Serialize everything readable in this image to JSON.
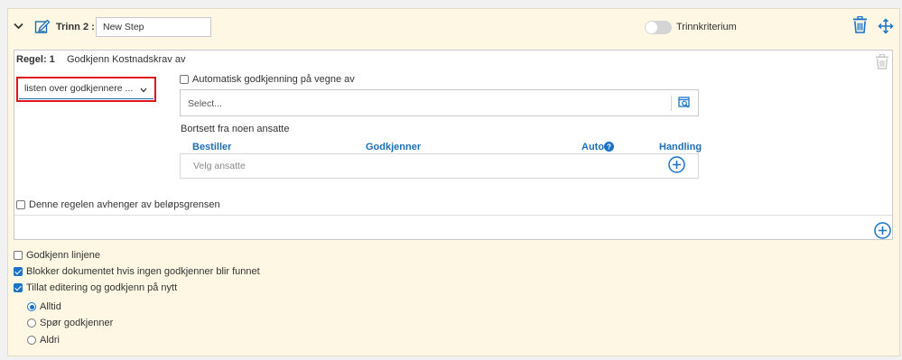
{
  "step": {
    "label": "Trinn 2 :",
    "name_value": "New Step",
    "criteria_label": "Trinnkriterium",
    "criteria_enabled": false
  },
  "rule": {
    "number_label": "Regel: 1",
    "name": "Godkjenn Kostnadskrav av",
    "approver_select": "listen over godkjennere ...",
    "auto_approve_label": "Automatisk godkjenning på vegne av",
    "auto_approve_checked": false,
    "select_placeholder": "Select...",
    "exclude_label": "Bortsett fra noen ansatte",
    "table": {
      "col_orderer": "Bestiller",
      "col_approver": "Godkjenner",
      "col_auto": "Auto",
      "col_action": "Handling",
      "empty_text": "Velg ansatte"
    },
    "amount_dependency_label": "Denne regelen avhenger av beløpsgrensen",
    "amount_dependency_checked": false
  },
  "options": [
    {
      "label": "Godkjenn linjene",
      "checked": false
    },
    {
      "label": "Blokker dokumentet hvis ingen godkjenner blir funnet",
      "checked": true
    },
    {
      "label": "Tillat editering og godkjenn på nytt",
      "checked": true
    }
  ],
  "edit_mode": [
    {
      "label": "Alltid",
      "selected": true
    },
    {
      "label": "Spør godkjenner",
      "selected": false
    },
    {
      "label": "Aldri",
      "selected": false
    }
  ],
  "colors": {
    "accent": "#1a73c7",
    "panel_bg": "#fdf7e3",
    "highlight": "#e0141b"
  },
  "icons": [
    "chevron-down-icon",
    "edit-step-icon",
    "trash-icon",
    "move-icon",
    "trash-disabled-icon",
    "lookup-icon",
    "info-icon",
    "add-circle-icon"
  ]
}
